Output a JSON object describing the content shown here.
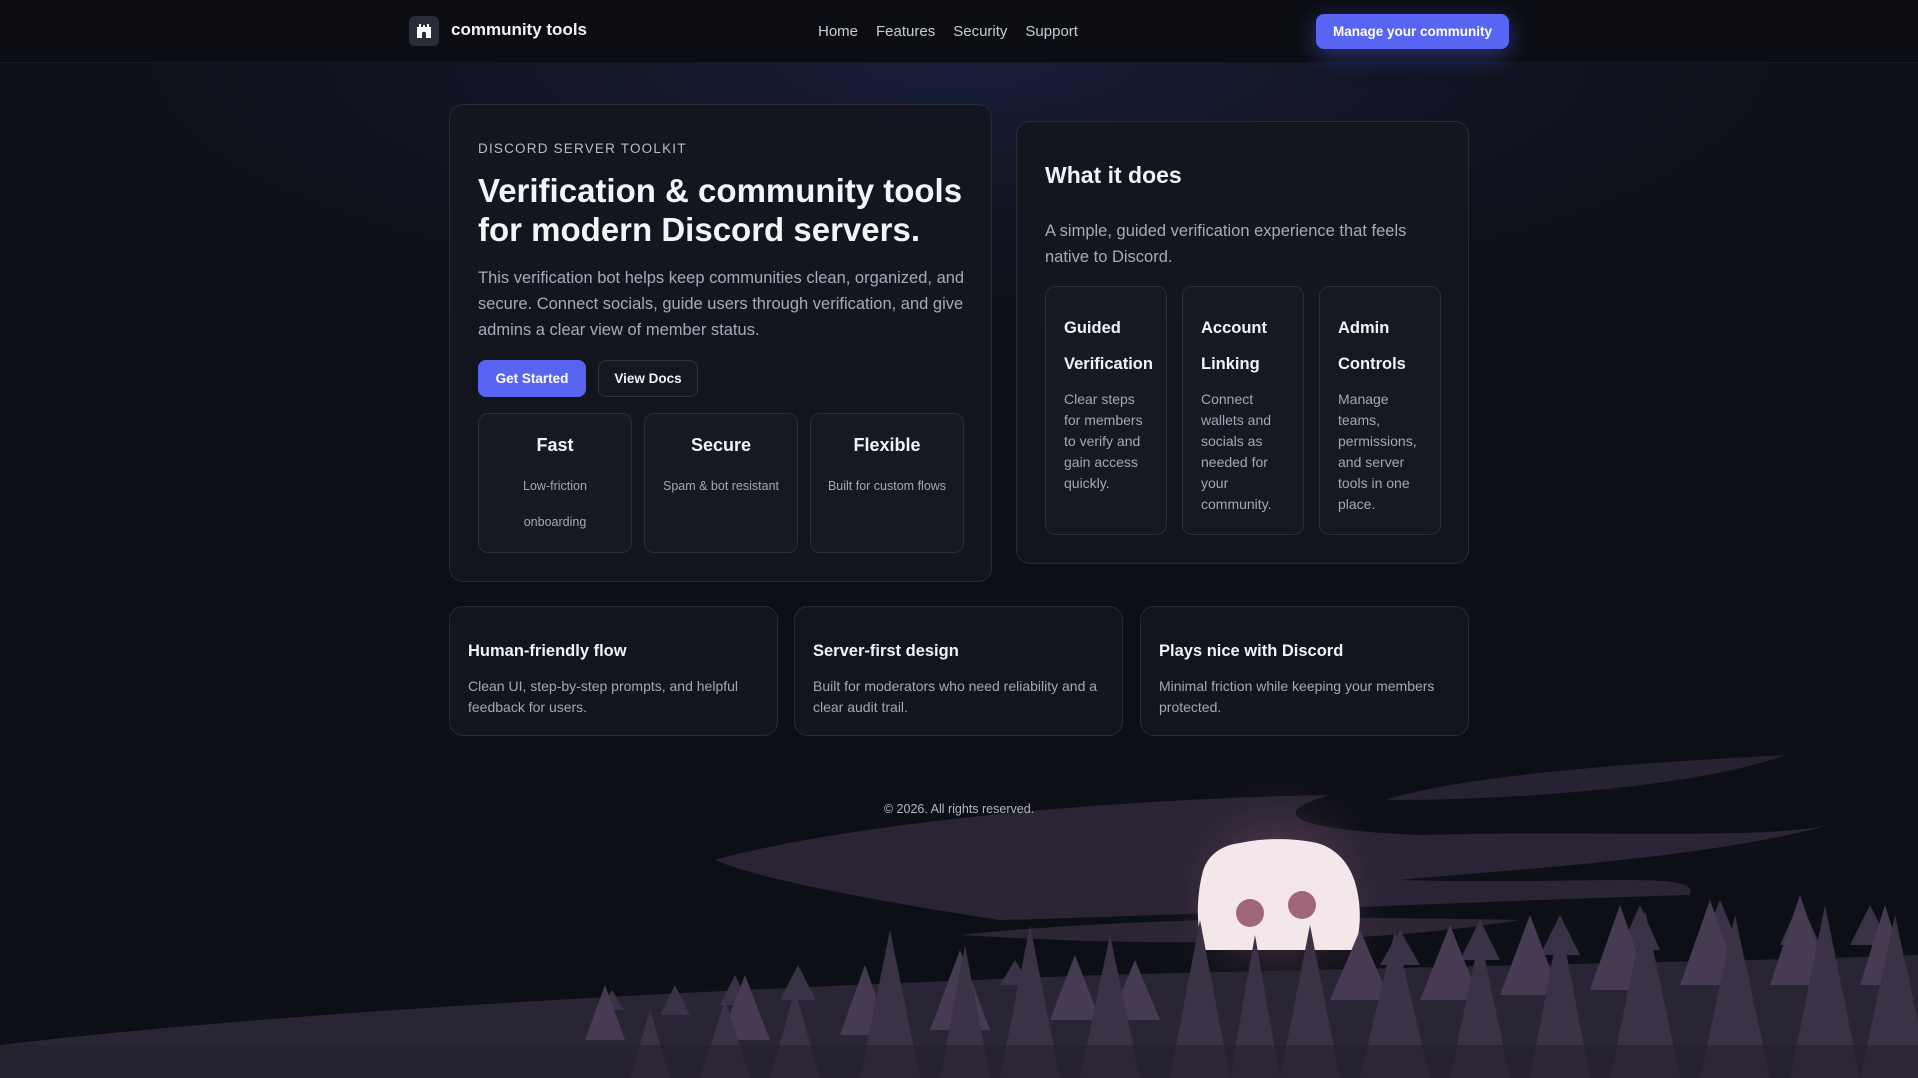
{
  "header": {
    "brand": "community tools",
    "logo_icon": "castle-icon",
    "nav": [
      "Home",
      "Features",
      "Security",
      "Support"
    ],
    "cta_label": "Manage your community"
  },
  "hero": {
    "eyebrow": "DISCORD SERVER TOOLKIT",
    "title": "Verification & community tools for modern Discord servers.",
    "description": "This verification bot helps keep communities clean, organized, and secure. Connect socials, guide users through verification, and give admins a clear view of member status.",
    "primary_button": "Get Started",
    "secondary_button": "View Docs",
    "highlights": [
      {
        "title": "Fast",
        "text": "Low-friction onboarding"
      },
      {
        "title": "Secure",
        "text": "Spam & bot resistant"
      },
      {
        "title": "Flexible",
        "text": "Built for custom flows"
      }
    ]
  },
  "what_it_does": {
    "title": "What it does",
    "description": "A simple, guided verification experience that feels native to Discord.",
    "features": [
      {
        "title": "Guided Verification",
        "text": "Clear steps for members to verify and gain access quickly."
      },
      {
        "title": "Account Linking",
        "text": "Connect wallets and socials as needed for your community."
      },
      {
        "title": "Admin Controls",
        "text": "Manage teams, permissions, and server tools in one place."
      }
    ]
  },
  "benefits": [
    {
      "title": "Human-friendly flow",
      "text": "Clean UI, step-by-step prompts, and helpful feedback for users."
    },
    {
      "title": "Server-first design",
      "text": "Built for moderators who need reliability and a clear audit trail."
    },
    {
      "title": "Plays nice with Discord",
      "text": "Minimal friction while keeping your members protected."
    }
  ],
  "footer": {
    "copyright": "© 2026. All rights reserved."
  },
  "colors": {
    "accent": "#5865f2",
    "background": "#0d0f16",
    "card": "#14161f"
  }
}
